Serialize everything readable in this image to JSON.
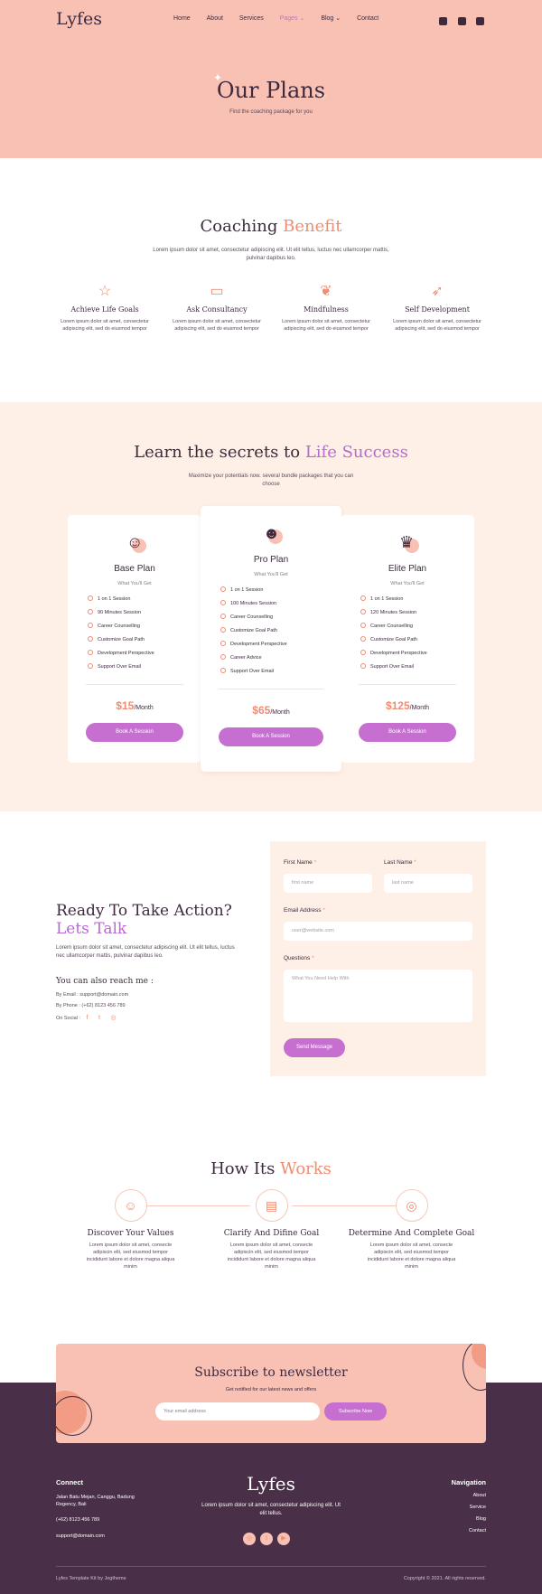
{
  "nav": {
    "logo": "Lyfes",
    "items": [
      "Home",
      "About",
      "Services",
      "Pages ⌄",
      "Blog ⌄",
      "Contact"
    ],
    "social": [
      "instagram-icon",
      "twitter-icon",
      "youtube-icon"
    ]
  },
  "hero": {
    "title": "Our Plans",
    "subtitle": "Find the coaching package for you"
  },
  "benefit": {
    "title_a": "Coaching ",
    "title_b": "Benefit",
    "lead": "Lorem ipsum dolor sit amet, consectetur adipiscing elit. Ut elit tellus, luctus nec ullamcorper mattis, pulvinar dapibus leo.",
    "items": [
      {
        "icon": "star-icon",
        "title": "Achieve Life Goals",
        "desc": "Lorem ipsum dolor sit amet, consectetur adipiscing elit, sed do eiusmod tempor"
      },
      {
        "icon": "chat-icon",
        "title": "Ask Consultancy",
        "desc": "Lorem ipsum dolor sit amet, consectetur adipiscing elit, sed do eiusmod tempor"
      },
      {
        "icon": "leaf-icon",
        "title": "Mindfulness",
        "desc": "Lorem ipsum dolor sit amet, consectetur adipiscing elit, sed do eiusmod tempor"
      },
      {
        "icon": "rocket-icon",
        "title": "Self Development",
        "desc": "Lorem ipsum dolor sit amet, consectetur adipiscing elit, sed do eiusmod tempor"
      }
    ]
  },
  "plans": {
    "title_a": "Learn the secrets to ",
    "title_b": "Life Success",
    "lead": "Maximize your potentials now. several bundle packages that you can choose",
    "cards": [
      {
        "name": "Base Plan",
        "ww": "What You'll Get",
        "features": [
          "1 on 1 Session",
          "90 Minutes Session",
          "Career Counselling",
          "Customize Goal Path",
          "Development Perspective",
          "Support Over Email"
        ],
        "price": "$15",
        "per": "/Month",
        "button": "Book A Session"
      },
      {
        "name": "Pro Plan",
        "ww": "What You'll Get",
        "features": [
          "1 on 1 Session",
          "100 Minutes Session",
          "Career Counselling",
          "Customize Goal Path",
          "Development Perspective",
          "Career Advice",
          "Support Over Email"
        ],
        "price": "$65",
        "per": "/Month",
        "button": "Book A Session"
      },
      {
        "name": "Elite Plan",
        "ww": "What You'll Get",
        "features": [
          "1 on 1 Session",
          "120 Minutes Session",
          "Career Counselling",
          "Customize Goal Path",
          "Development Perspective",
          "Support Over Email"
        ],
        "price": "$125",
        "per": "/Month",
        "button": "Book A Session"
      }
    ]
  },
  "contact": {
    "title_a": "Ready To Take Action?",
    "title_b": "Lets Talk",
    "text": "Lorem ipsum dolor sit amet, consectetur adipiscing elit. Ut elit tellus, luctus nec ullamcorper mattis, pulvinar dapibus leo.",
    "reach": "You can also reach me :",
    "email": "By Email : support@domain.com",
    "phone": "By Phone : (+62) 8123 456 789",
    "social": "On Social :",
    "form": {
      "first_label": "First Name",
      "first_ph": "first name",
      "last_label": "Last Name",
      "last_ph": "last name",
      "email_label": "Email Address",
      "email_ph": "user@website.com",
      "q_label": "Questions",
      "q_ph": "What You Need Help With",
      "required": "*",
      "button": "Send Message"
    }
  },
  "how": {
    "title_a": "How Its ",
    "title_b": "Works",
    "steps": [
      {
        "icon": "mind-icon",
        "title": "Discover Your Values",
        "desc": "Lorem ipsum dolor sit amet, consecte adipiscin elit, sed eiusmod tempor incididunt labore et dolore magna aliqua minim"
      },
      {
        "icon": "clipboard-icon",
        "title": "Clarify And Difine Goal",
        "desc": "Lorem ipsum dolor sit amet, consecte adipiscin elit, sed eiusmod tempor incididunt labore et dolore magna aliqua minim"
      },
      {
        "icon": "target-icon",
        "title": "Determine And Complete Goal",
        "desc": "Lorem ipsum dolor sit amet, consecte adipiscin elit, sed eiusmod tempor incididunt labore et dolore magna aliqua minim"
      }
    ]
  },
  "newsletter": {
    "title": "Subscribe to newsletter",
    "sub": "Get notified for our latest news and offers",
    "placeholder": "Your email address",
    "button": "Subscribe Now"
  },
  "footer": {
    "connect_h": "Connect",
    "address": "Jalan Batu Mejan, Canggu, Badung Regency, Bali",
    "phone": "(+62) 8123 456 789",
    "email": "support@domain.com",
    "logo": "Lyfes",
    "desc": "Lorem ipsum dolor sit amet, consectetur adipiscing elit. Ut elit tellus.",
    "nav_h": "Navigation",
    "nav": [
      "About",
      "Service",
      "Blog",
      "Contact"
    ],
    "credit": "Lyfes Template Kit by Jegtheme",
    "copyright": "Copyright © 2021. All rights reserved."
  },
  "colors": {
    "peach": "#f9c1b4",
    "cream": "#fff0e7",
    "orange": "#f08c70",
    "purple": "#c66fd1",
    "plum": "#492f47"
  }
}
